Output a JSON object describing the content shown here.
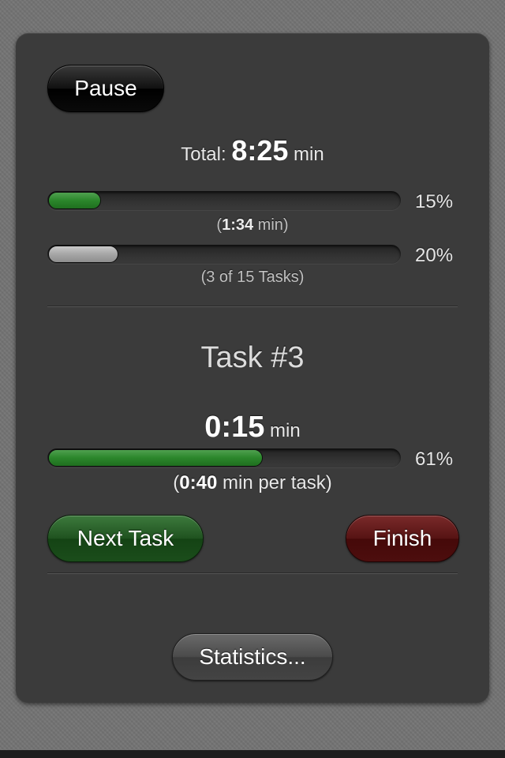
{
  "controls": {
    "pause_label": "Pause",
    "next_task_label": "Next Task",
    "finish_label": "Finish",
    "statistics_label": "Statistics..."
  },
  "total": {
    "prefix": "Total:",
    "time": "8:25",
    "unit": "min"
  },
  "time_progress": {
    "percent_label": "15%",
    "percent": 15,
    "open_paren": "(",
    "time": "1:34",
    "suffix": " min)"
  },
  "task_progress": {
    "percent_label": "20%",
    "percent": 20,
    "text": "(3 of 15 Tasks)"
  },
  "current_task": {
    "title": "Task #3",
    "time": "0:15",
    "unit": "min",
    "percent_label": "61%",
    "percent": 61,
    "open_paren": "(",
    "per_task_time": "0:40",
    "per_task_suffix": " min per task)"
  },
  "colors": {
    "panel": "#3b3b3b",
    "progress_green": "#2b862b",
    "progress_gray": "#a6a6a6",
    "next_button": "#1f521f",
    "finish_button": "#561313"
  }
}
